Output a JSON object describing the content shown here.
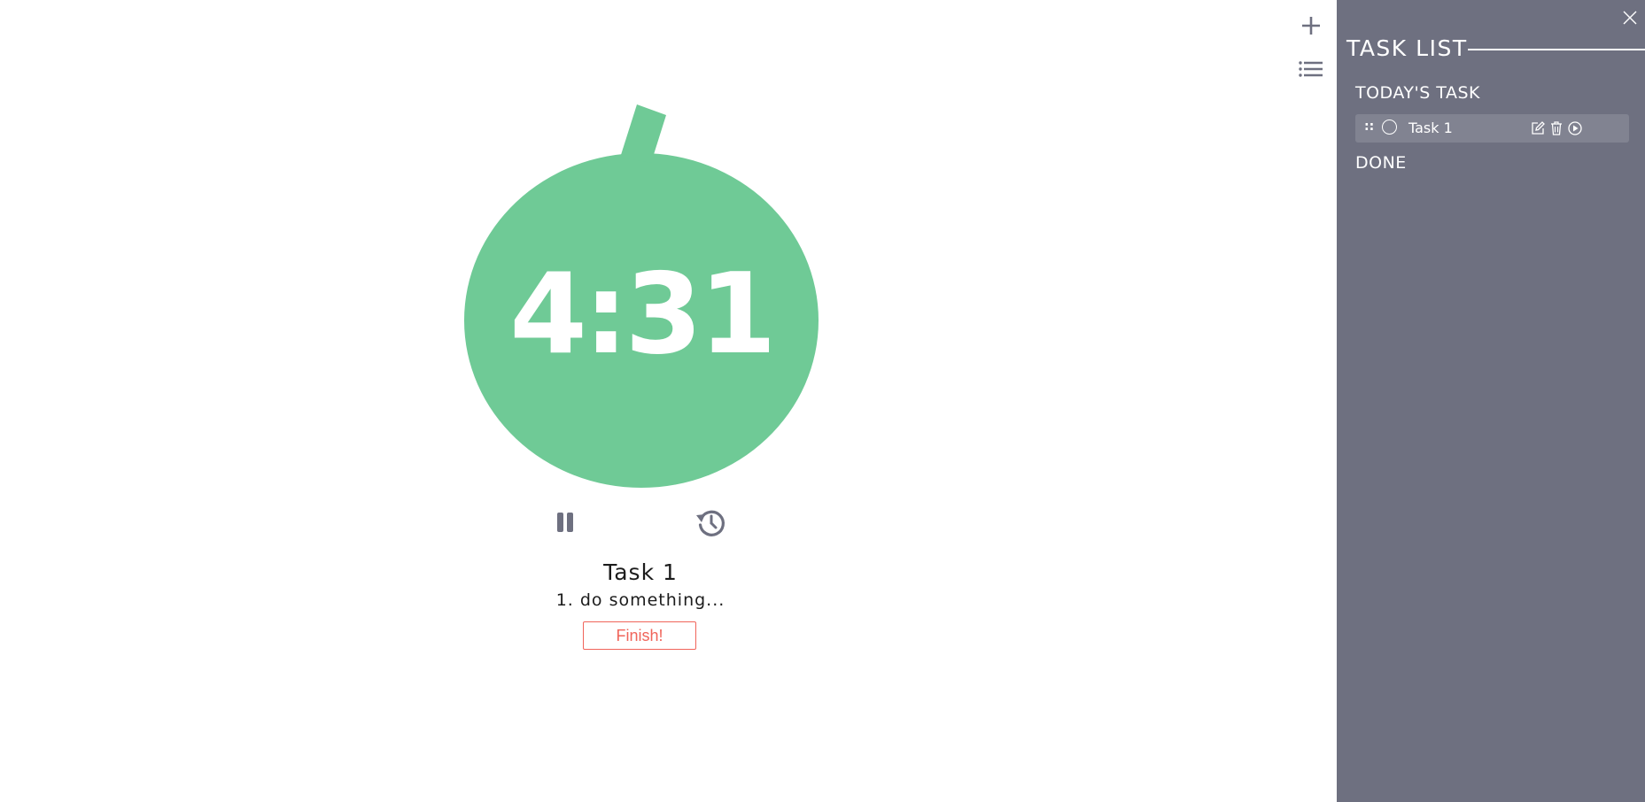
{
  "colors": {
    "accent_green": "#6fca96",
    "panel_bg": "#6e7080",
    "task_row_bg": "#818391",
    "icon_gray": "#6e7080",
    "finish_red": "#f0645a"
  },
  "toolbar": {
    "add_icon": "plus-icon",
    "list_icon": "list-icon"
  },
  "timer": {
    "display": "4:31"
  },
  "controls": {
    "pause_icon": "pause-icon",
    "reset_icon": "history-icon"
  },
  "current_task": {
    "title": "Task 1",
    "note": "1. do something...",
    "finish_label": "Finish!"
  },
  "task_panel": {
    "title": "TASK LIST",
    "close_icon": "close-icon",
    "today_heading": "TODAY'S TASK",
    "tasks": [
      {
        "label": "Task 1"
      }
    ],
    "done_heading": "DONE"
  }
}
